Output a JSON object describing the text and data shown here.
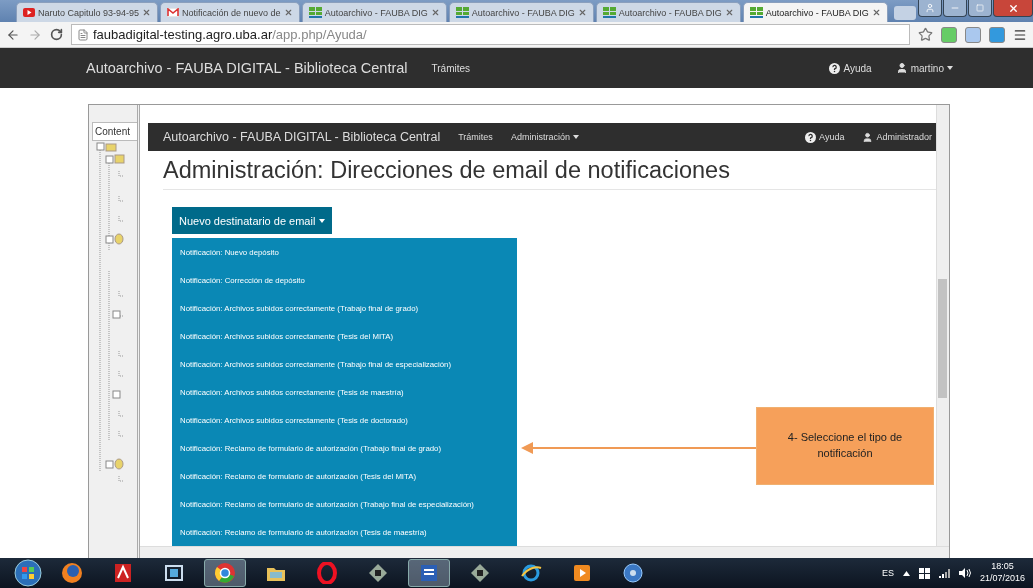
{
  "browser": {
    "tabs": [
      {
        "title": "Naruto Capitulo 93-94-95",
        "kind": "video",
        "selected": false
      },
      {
        "title": "Notificación de nuevo de",
        "kind": "mail",
        "selected": false
      },
      {
        "title": "Autoarchivo - FAUBA DIG",
        "kind": "grid",
        "selected": false
      },
      {
        "title": "Autoarchivo - FAUBA DIG",
        "kind": "grid",
        "selected": false
      },
      {
        "title": "Autoarchivo - FAUBA DIG",
        "kind": "grid",
        "selected": false
      },
      {
        "title": "Autoarchivo - FAUBA DIG",
        "kind": "grid",
        "selected": true
      }
    ],
    "address": {
      "host": "faubadigital-testing.agro.uba.ar",
      "path": "/app.php/Ayuda/"
    }
  },
  "site_nav": {
    "brand": "Autoarchivo - FAUBA DIGITAL - Biblioteca Central",
    "links": [
      "Trámites"
    ],
    "help": "Ayuda",
    "user": "martino"
  },
  "help_viewer": {
    "sidebar_tab": "Content",
    "page": {
      "nav": {
        "brand": "Autoarchivo - FAUBA DIGITAL - Biblioteca Central",
        "links": [
          {
            "label": "Trámites",
            "dropdown": false
          },
          {
            "label": "Administración",
            "dropdown": true
          }
        ],
        "help": "Ayuda",
        "user": "Administrador"
      },
      "title": "Administración: Direcciones de email de notificaciones",
      "dropdown": {
        "label": "Nuevo destinatario de email",
        "expanded": true,
        "items": [
          "Notificación: Nuevo depósito",
          "Notificación: Corrección de depósito",
          "Notificación: Archivos subidos correctamente (Trabajo final de grado)",
          "Notificación: Archivos subidos correctamente (Tesis del MITA)",
          "Notificación: Archivos subidos correctamente (Trabajo final de especialización)",
          "Notificación: Archivos subidos correctamente (Tesis de maestría)",
          "Notificación: Archivos subidos correctamente (Tesis de doctorado)",
          "Notificación: Reclamo de formulario de autorización (Trabajo final de grado)",
          "Notificación: Reclamo de formulario de autorización (Tesis del MITA)",
          "Notificación: Reclamo de formulario de autorización (Trabajo final de especialización)",
          "Notificación: Reclamo de formulario de autorización (Tesis de maestría)"
        ]
      },
      "callout": "4- Seleccione el tipo de notificación"
    }
  },
  "taskbar": {
    "apps": [
      {
        "kind": "globe",
        "selected": false
      },
      {
        "kind": "pdf",
        "selected": false
      },
      {
        "kind": "film",
        "selected": false
      },
      {
        "kind": "wheel",
        "selected": true
      },
      {
        "kind": "folder",
        "selected": false
      },
      {
        "kind": "ring",
        "selected": false
      },
      {
        "kind": "diamond",
        "selected": false
      },
      {
        "kind": "doc",
        "selected": true
      },
      {
        "kind": "diamond",
        "selected": false
      },
      {
        "kind": "swirl",
        "selected": false
      },
      {
        "kind": "play",
        "selected": false
      },
      {
        "kind": "disc",
        "selected": false
      }
    ],
    "language": "ES",
    "time": "18:05",
    "date": "21/07/2016"
  }
}
